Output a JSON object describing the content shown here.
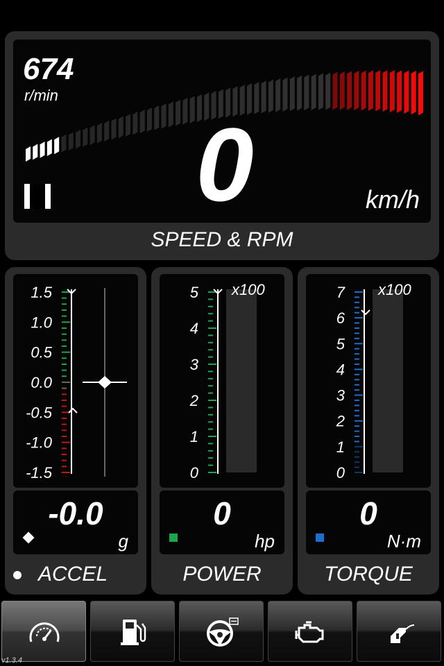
{
  "speed_rpm": {
    "rpm_value": "674",
    "rpm_unit": "r/min",
    "gear": "I",
    "speed_value": "0",
    "speed_unit": "km/h",
    "panel_label": "SPEED & RPM"
  },
  "accel": {
    "scale": [
      "1.5",
      "1.0",
      "0.5",
      "0.0",
      "-0.5",
      "-1.0",
      "-1.5"
    ],
    "value": "-0.0",
    "unit": "g",
    "panel_label": "ACCEL",
    "indicator_color": "#ffffff"
  },
  "power": {
    "scale": [
      "5",
      "4",
      "3",
      "2",
      "1",
      "0"
    ],
    "multiplier": "x100",
    "value": "0",
    "unit": "hp",
    "panel_label": "POWER",
    "indicator_color": "#1aa84a"
  },
  "torque": {
    "scale": [
      "7",
      "6",
      "5",
      "4",
      "3",
      "2",
      "1",
      "0"
    ],
    "multiplier": "x100",
    "value": "0",
    "unit": "N·m",
    "panel_label": "TORQUE",
    "indicator_color": "#1a6fd0"
  },
  "tabs": [
    {
      "icon": "speedometer-icon",
      "active": true
    },
    {
      "icon": "fuel-pump-icon",
      "active": false
    },
    {
      "icon": "steering-wheel-icon",
      "active": false
    },
    {
      "icon": "engine-icon",
      "active": false
    },
    {
      "icon": "fuel-nozzle-icon",
      "active": false
    }
  ],
  "version": "v1.3.4",
  "colors": {
    "redline": "#e01010",
    "accel_red": "#cc1111",
    "power_green": "#1aa84a",
    "torque_blue": "#1a6fd0"
  }
}
